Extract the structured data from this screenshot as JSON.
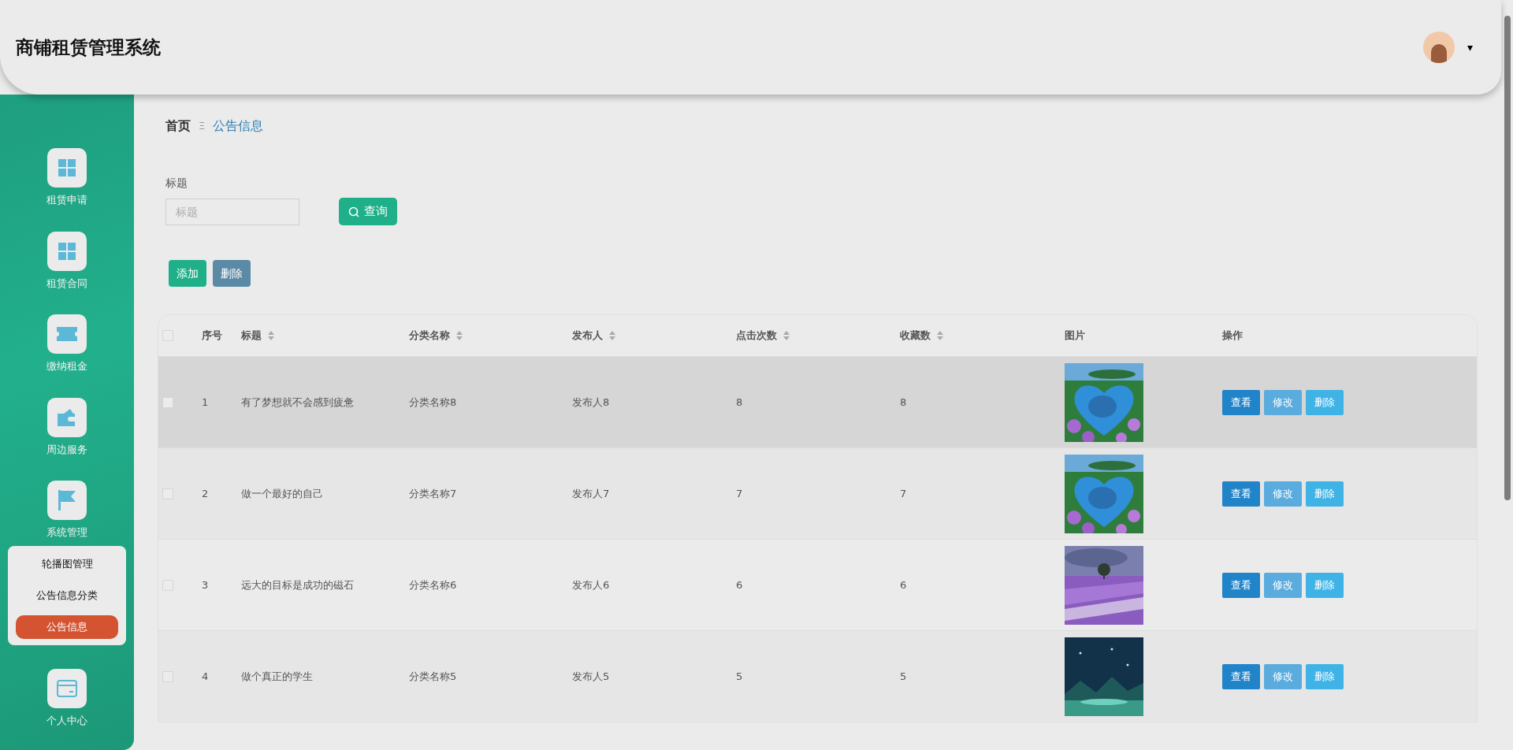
{
  "header": {
    "title": "商铺租赁管理系统",
    "user_menu": {
      "caret": "▾"
    }
  },
  "sidebar": {
    "items": [
      {
        "label": "租赁申请"
      },
      {
        "label": "租赁合同"
      },
      {
        "label": "缴纳租金"
      },
      {
        "label": "周边服务"
      },
      {
        "label": "系统管理",
        "children": [
          {
            "label": "轮播图管理",
            "selected": false
          },
          {
            "label": "公告信息分类",
            "selected": false
          },
          {
            "label": "公告信息",
            "selected": true
          }
        ]
      },
      {
        "label": "个人中心"
      }
    ]
  },
  "breadcrumb": {
    "home": "首页",
    "separator": "Ξ",
    "current": "公告信息"
  },
  "search": {
    "label": "标题",
    "placeholder": "标题",
    "button": "查询"
  },
  "actions": [
    {
      "label": "添加",
      "kind": "add"
    },
    {
      "label": "删除",
      "kind": "delete"
    }
  ],
  "table": {
    "select_all": {
      "checked": false
    },
    "columns": [
      {
        "label": "序号",
        "sortable": false
      },
      {
        "label": "标题",
        "sortable": true
      },
      {
        "label": "分类名称",
        "sortable": true
      },
      {
        "label": "发布人",
        "sortable": true
      },
      {
        "label": "点击次数",
        "sortable": true
      },
      {
        "label": "收藏数",
        "sortable": true
      },
      {
        "label": "图片",
        "sortable": false
      },
      {
        "label": "操作",
        "sortable": false
      }
    ],
    "rows": [
      {
        "index": "1",
        "title": "有了梦想就不会感到疲惫",
        "category": "分类名称8",
        "publisher": "发布人8",
        "clicks": "8",
        "favorites": "8",
        "picture": {
          "kind": "picture"
        },
        "checked": false,
        "highlighted": true,
        "buttons": [
          {
            "label": "查看",
            "kind": "view"
          },
          {
            "label": "修改",
            "kind": "edit"
          },
          {
            "label": "删除",
            "kind": "delete"
          }
        ]
      },
      {
        "index": "2",
        "title": "做一个最好的自己",
        "category": "分类名称7",
        "publisher": "发布人7",
        "clicks": "7",
        "favorites": "7",
        "picture": {
          "kind": "picture"
        },
        "checked": false,
        "highlighted": false,
        "buttons": [
          {
            "label": "查看",
            "kind": "view"
          },
          {
            "label": "修改",
            "kind": "edit"
          },
          {
            "label": "删除",
            "kind": "delete"
          }
        ]
      },
      {
        "index": "3",
        "title": "远大的目标是成功的磁石",
        "category": "分类名称6",
        "publisher": "发布人6",
        "clicks": "6",
        "favorites": "6",
        "picture": {
          "kind": "picture"
        },
        "checked": false,
        "highlighted": false,
        "buttons": [
          {
            "label": "查看",
            "kind": "view"
          },
          {
            "label": "修改",
            "kind": "edit"
          },
          {
            "label": "删除",
            "kind": "delete"
          }
        ]
      },
      {
        "index": "4",
        "title": "做个真正的学生",
        "category": "分类名称5",
        "publisher": "发布人5",
        "clicks": "5",
        "favorites": "5",
        "picture": {
          "kind": "picture"
        },
        "checked": false,
        "highlighted": false,
        "buttons": [
          {
            "label": "查看",
            "kind": "view"
          },
          {
            "label": "修改",
            "kind": "edit"
          },
          {
            "label": "删除",
            "kind": "delete"
          }
        ]
      }
    ]
  }
}
